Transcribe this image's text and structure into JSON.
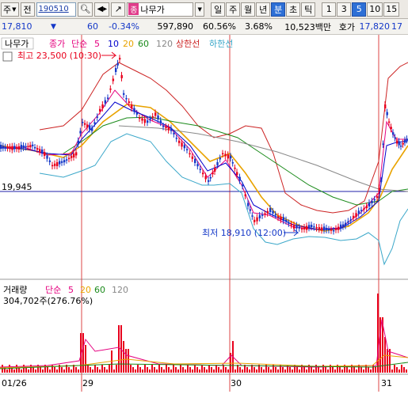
{
  "toolbar": {
    "market_label": "주",
    "prev_label": "전",
    "code_value": "190510",
    "stock_name": "나무가",
    "stock_tag": "종",
    "period_buttons": [
      "일",
      "주",
      "월",
      "년",
      "분",
      "초",
      "틱"
    ],
    "active_period": "분",
    "interval_buttons": [
      "1",
      "3",
      "5",
      "10",
      "15"
    ],
    "active_interval": "5"
  },
  "quote": {
    "price": "17,810",
    "change": "60",
    "change_pct": "-0.34%",
    "volume": "597,890",
    "volume_ratio": "60.56%",
    "turnover_rate": "3.68%",
    "amount": "10,523백만",
    "ask_label": "호가",
    "ask_price": "17,820",
    "extra": "17"
  },
  "price_chart": {
    "legend": {
      "name": "나무가",
      "close": "종가",
      "ma_type": "단순",
      "ma_periods": [
        "5",
        "10",
        "20",
        "60",
        "120"
      ],
      "upper_limit": "상한선",
      "lower_limit": "하한선"
    },
    "high_label": "최고 23,500 (10:30)",
    "low_label": "최저 18,910 (12:00)",
    "ref_label": "19,945"
  },
  "volume_chart": {
    "legend": {
      "name": "거래량",
      "ma_type": "단순",
      "ma_periods": [
        "5",
        "20",
        "60",
        "120"
      ]
    },
    "value_label": "304,702주(276.76%)"
  },
  "x_axis": {
    "labels": [
      "01/26",
      "29",
      "30",
      "31"
    ]
  },
  "colors": {
    "up": "#e8001c",
    "down": "#1438c8",
    "ma5": "#e5007f",
    "ma10": "#0000cc",
    "ma20": "#e9a300",
    "ma60": "#1a8a1a",
    "ma120": "#888888",
    "envelope_upper": "#cc2222",
    "envelope_lower": "#3aa7c9",
    "ref_line": "#2222aa",
    "divider": "#dd4444"
  }
}
